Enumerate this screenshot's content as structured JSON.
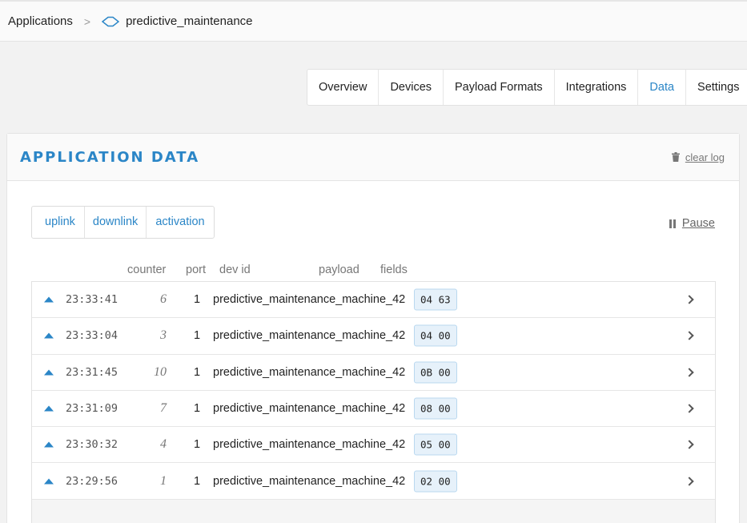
{
  "breadcrumb": {
    "root": "Applications",
    "separator": ">",
    "app": "predictive_maintenance"
  },
  "tabs": [
    {
      "label": "Overview",
      "active": false
    },
    {
      "label": "Devices",
      "active": false
    },
    {
      "label": "Payload Formats",
      "active": false
    },
    {
      "label": "Integrations",
      "active": false
    },
    {
      "label": "Data",
      "active": true
    },
    {
      "label": "Settings",
      "active": false
    }
  ],
  "panel": {
    "title": "APPLICATION DATA",
    "clear_log": "clear log"
  },
  "filters": [
    "uplink",
    "downlink",
    "activation"
  ],
  "pause_label": "Pause",
  "columns": {
    "counter": "counter",
    "port": "port",
    "dev_id": "dev id",
    "payload": "payload",
    "fields": "fields"
  },
  "rows": [
    {
      "time": "23:33:41",
      "counter": "6",
      "port": "1",
      "dev_id": "predictive_maintenance_machine_42",
      "payload": "04 63"
    },
    {
      "time": "23:33:04",
      "counter": "3",
      "port": "1",
      "dev_id": "predictive_maintenance_machine_42",
      "payload": "04 00"
    },
    {
      "time": "23:31:45",
      "counter": "10",
      "port": "1",
      "dev_id": "predictive_maintenance_machine_42",
      "payload": "0B 00"
    },
    {
      "time": "23:31:09",
      "counter": "7",
      "port": "1",
      "dev_id": "predictive_maintenance_machine_42",
      "payload": "08 00"
    },
    {
      "time": "23:30:32",
      "counter": "4",
      "port": "1",
      "dev_id": "predictive_maintenance_machine_42",
      "payload": "05 00"
    },
    {
      "time": "23:29:56",
      "counter": "1",
      "port": "1",
      "dev_id": "predictive_maintenance_machine_42",
      "payload": "02 00"
    }
  ],
  "colors": {
    "accent": "#2b86c7",
    "payload_bg": "#e6f1fa"
  }
}
